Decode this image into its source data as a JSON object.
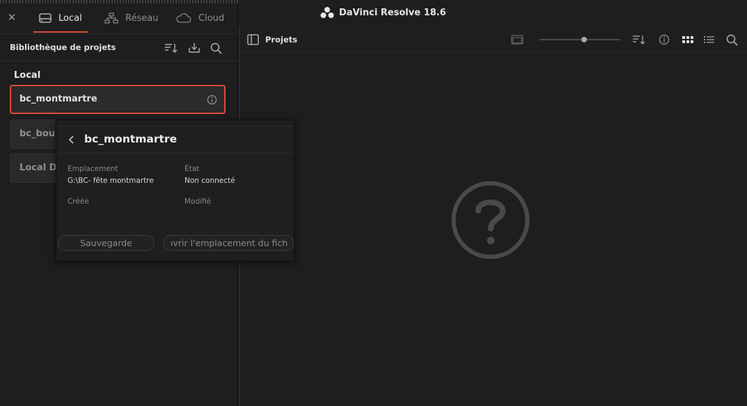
{
  "window": {
    "title": "DaVinci Resolve 18.6"
  },
  "tabs": [
    {
      "label": "Local",
      "icon": "drive-icon",
      "active": true
    },
    {
      "label": "Réseau",
      "icon": "network-icon",
      "active": false
    },
    {
      "label": "Cloud",
      "icon": "cloud-icon",
      "active": false
    }
  ],
  "library": {
    "title": "Bibliothèque de projets",
    "section": "Local",
    "projects": [
      {
        "name": "bc_montmartre",
        "selected": true
      },
      {
        "name": "bc_bour",
        "selected": false
      },
      {
        "name": "Local Da",
        "selected": false
      }
    ]
  },
  "projects_panel": {
    "title": "Projets",
    "slider_fraction": 0.55
  },
  "popup": {
    "title": "bc_montmartre",
    "location_label": "Emplacement",
    "location_value": "G:\\BC- fête montmartre",
    "state_label": "État",
    "state_value": "Non connecté",
    "created_label": "Créée",
    "modified_label": "Modifié",
    "backup_button": "Sauvegarde",
    "open_location_button": "ıvrir l'emplacement du fich"
  },
  "colors": {
    "accent": "#e14a3a",
    "background": "#1e1e1f"
  }
}
